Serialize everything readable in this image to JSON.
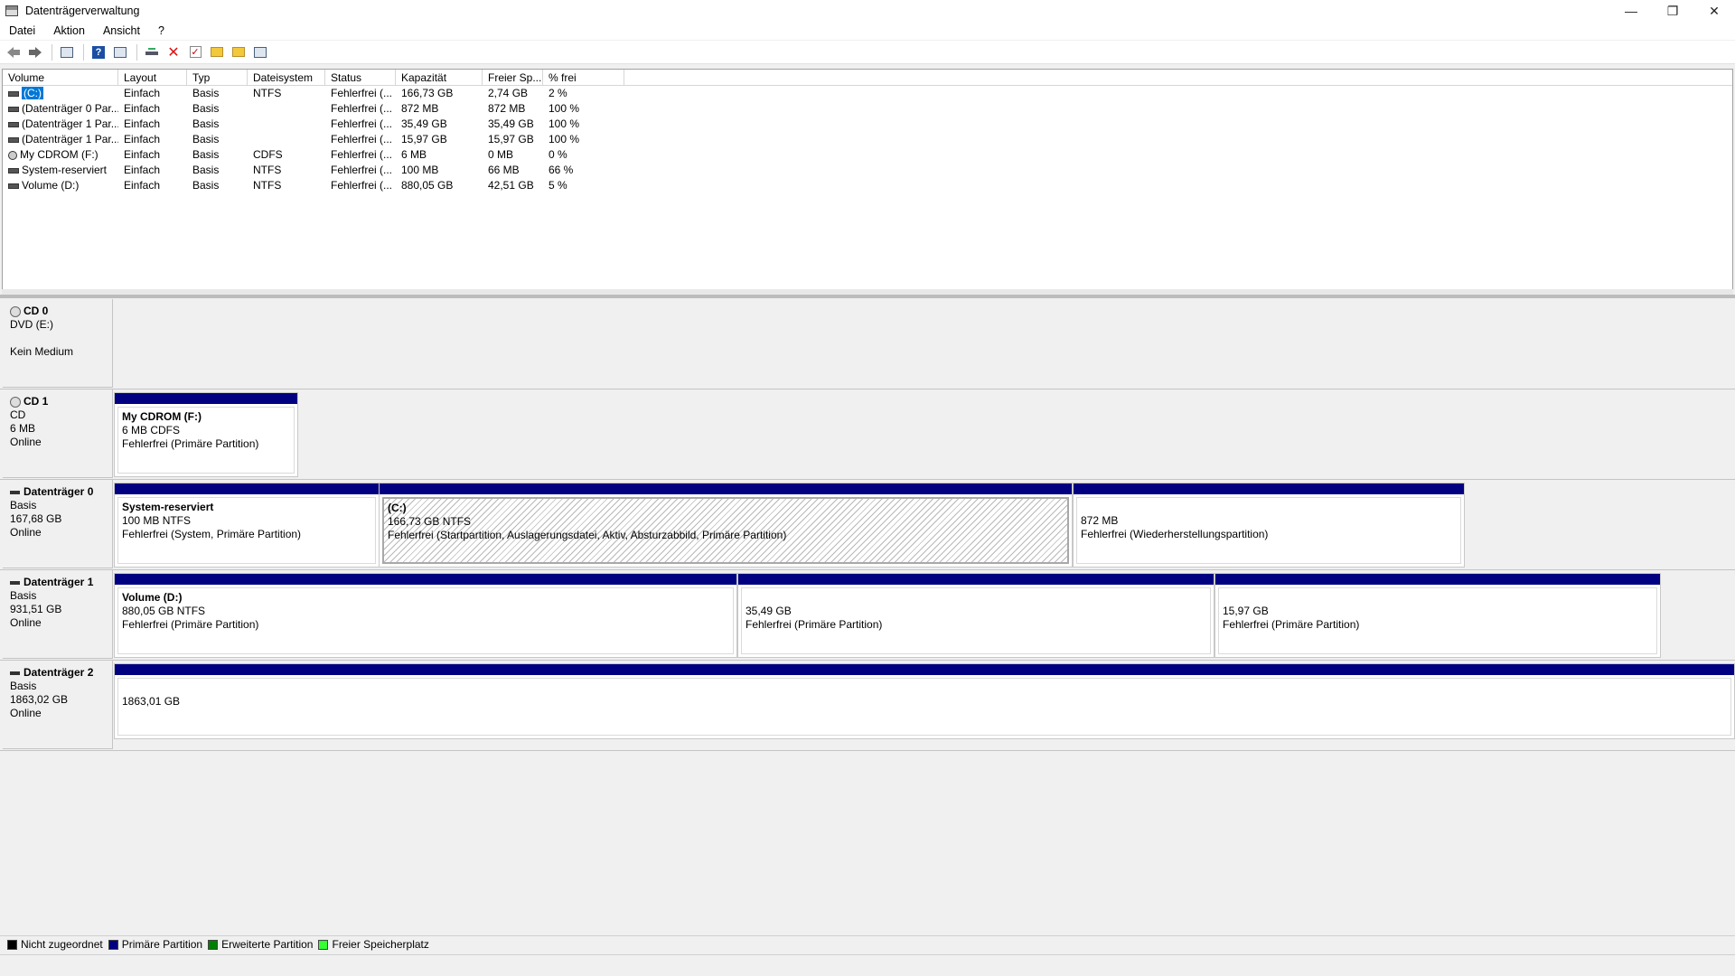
{
  "window": {
    "title": "Datenträgerverwaltung"
  },
  "window_buttons": {
    "minimize": "—",
    "restore": "❐",
    "close": "✕"
  },
  "menu": [
    "Datei",
    "Aktion",
    "Ansicht",
    "?"
  ],
  "toolbar_icons": [
    "back-icon",
    "forward-icon",
    "console-tree-icon",
    "help-icon",
    "properties-icon",
    "connect-drive-icon",
    "delete-icon",
    "check-icon",
    "folder-up-icon",
    "folder-search-icon",
    "settings-icon"
  ],
  "volume_list": {
    "columns": [
      "Volume",
      "Layout",
      "Typ",
      "Dateisystem",
      "Status",
      "Kapazität",
      "Freier Sp...",
      "% frei"
    ],
    "rows": [
      {
        "icon": "drive",
        "volume": "(C:)",
        "layout": "Einfach",
        "typ": "Basis",
        "fs": "NTFS",
        "status": "Fehlerfrei (...",
        "cap": "166,73 GB",
        "free": "2,74 GB",
        "pct": "2 %"
      },
      {
        "icon": "drive",
        "volume": "(Datenträger 0 Par...",
        "layout": "Einfach",
        "typ": "Basis",
        "fs": "",
        "status": "Fehlerfrei (...",
        "cap": "872 MB",
        "free": "872 MB",
        "pct": "100 %"
      },
      {
        "icon": "drive",
        "volume": "(Datenträger 1 Par...",
        "layout": "Einfach",
        "typ": "Basis",
        "fs": "",
        "status": "Fehlerfrei (...",
        "cap": "35,49 GB",
        "free": "35,49 GB",
        "pct": "100 %"
      },
      {
        "icon": "drive",
        "volume": "(Datenträger 1 Par...",
        "layout": "Einfach",
        "typ": "Basis",
        "fs": "",
        "status": "Fehlerfrei (...",
        "cap": "15,97 GB",
        "free": "15,97 GB",
        "pct": "100 %"
      },
      {
        "icon": "cd",
        "volume": "My CDROM (F:)",
        "layout": "Einfach",
        "typ": "Basis",
        "fs": "CDFS",
        "status": "Fehlerfrei (...",
        "cap": "6 MB",
        "free": "0 MB",
        "pct": "0 %"
      },
      {
        "icon": "drive",
        "volume": "System-reserviert",
        "layout": "Einfach",
        "typ": "Basis",
        "fs": "NTFS",
        "status": "Fehlerfrei (...",
        "cap": "100 MB",
        "free": "66 MB",
        "pct": "66 %"
      },
      {
        "icon": "drive",
        "volume": "Volume (D:)",
        "layout": "Einfach",
        "typ": "Basis",
        "fs": "NTFS",
        "status": "Fehlerfrei (...",
        "cap": "880,05 GB",
        "free": "42,51 GB",
        "pct": "5 %"
      }
    ]
  },
  "disks": [
    {
      "name": "CD 0",
      "icon": "cd",
      "lines": [
        "DVD (E:)",
        "",
        "Kein Medium"
      ],
      "partitions": []
    },
    {
      "name": "CD 1",
      "icon": "cd",
      "lines": [
        "CD",
        "6 MB",
        "Online"
      ],
      "partitions": [
        {
          "name": "My CDROM  (F:)",
          "size": "6 MB CDFS",
          "status": "Fehlerfrei (Primäre Partition)",
          "hatched": false
        }
      ]
    },
    {
      "name": "Datenträger 0",
      "icon": "disk",
      "lines": [
        "Basis",
        "167,68 GB",
        "Online"
      ],
      "partitions": [
        {
          "name": "System-reserviert",
          "size": "100 MB NTFS",
          "status": "Fehlerfrei (System, Primäre Partition)",
          "hatched": false
        },
        {
          "name": "(C:)",
          "size": "166,73 GB NTFS",
          "status": "Fehlerfrei (Startpartition, Auslagerungsdatei, Aktiv, Absturzabbild, Primäre Partition)",
          "hatched": true
        },
        {
          "name": "",
          "size": "872 MB",
          "status": "Fehlerfrei (Wiederherstellungspartition)",
          "hatched": false
        }
      ]
    },
    {
      "name": "Datenträger 1",
      "icon": "disk",
      "lines": [
        "Basis",
        "931,51 GB",
        "Online"
      ],
      "partitions": [
        {
          "name": "Volume  (D:)",
          "size": "880,05 GB NTFS",
          "status": "Fehlerfrei (Primäre Partition)",
          "hatched": false
        },
        {
          "name": "",
          "size": "35,49 GB",
          "status": "Fehlerfrei (Primäre Partition)",
          "hatched": false
        },
        {
          "name": "",
          "size": "15,97 GB",
          "status": "Fehlerfrei (Primäre Partition)",
          "hatched": false
        }
      ]
    },
    {
      "name": "Datenträger 2",
      "icon": "disk",
      "lines": [
        "Basis",
        "1863,02 GB",
        "Online"
      ],
      "partitions": [
        {
          "name": "",
          "size": "1863,01 GB",
          "status": "",
          "hatched": false
        }
      ]
    }
  ],
  "legend": [
    {
      "label": "Nicht zugeordnet",
      "color": "#000000"
    },
    {
      "label": "Primäre Partition",
      "color": "#000080"
    },
    {
      "label": "Erweiterte Partition",
      "color": "#008000"
    },
    {
      "label": "Freier Speicherplatz",
      "color": "#33ff33"
    }
  ]
}
